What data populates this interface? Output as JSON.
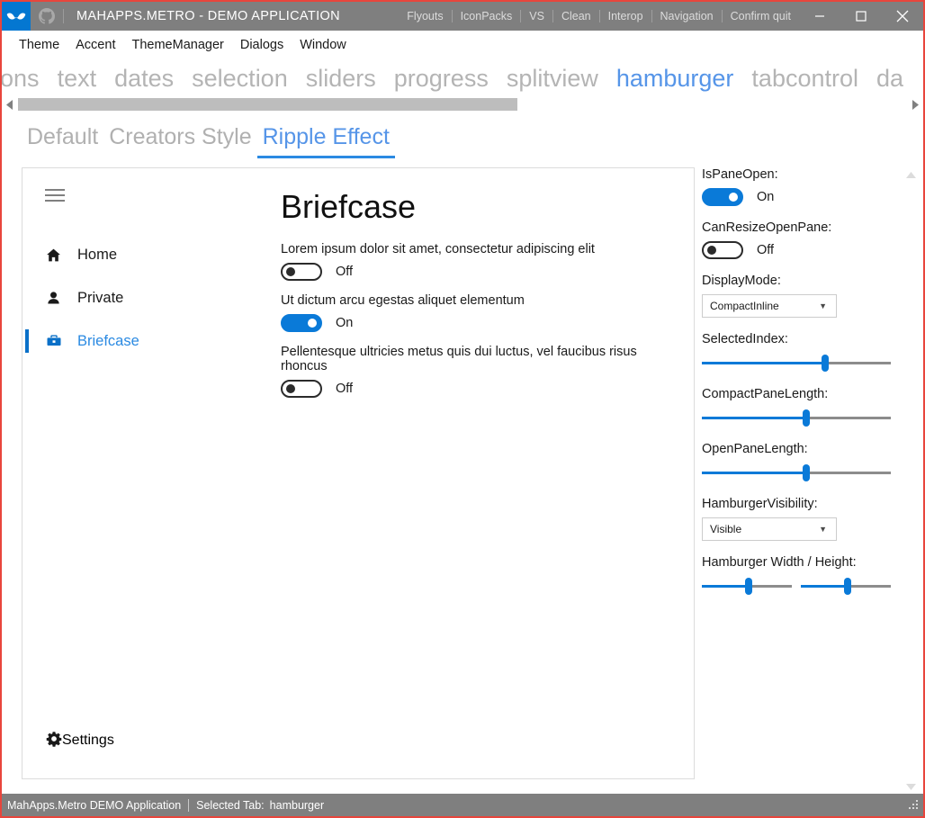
{
  "titlebar": {
    "logo_icon": "mahapps-mustache-logo",
    "github_icon": "github-octocat-icon",
    "title": "MAHAPPS.METRO - DEMO APPLICATION",
    "menu_items": [
      "Flyouts",
      "IconPacks",
      "VS",
      "Clean",
      "Interop",
      "Navigation",
      "Confirm quit"
    ],
    "window_buttons": [
      "minimize",
      "maximize",
      "close"
    ],
    "background": "#7f7f7f",
    "logo_background": "#0477d1"
  },
  "menubar": {
    "items": [
      "Theme",
      "Accent",
      "ThemeManager",
      "Dialogs",
      "Window"
    ]
  },
  "tabstrip": {
    "tabs": [
      {
        "label": "uttons",
        "selected": false
      },
      {
        "label": "text",
        "selected": false
      },
      {
        "label": "dates",
        "selected": false
      },
      {
        "label": "selection",
        "selected": false
      },
      {
        "label": "sliders",
        "selected": false
      },
      {
        "label": "progress",
        "selected": false
      },
      {
        "label": "splitview",
        "selected": false
      },
      {
        "label": "hamburger",
        "selected": true
      },
      {
        "label": "tabcontrol",
        "selected": false
      },
      {
        "label": "da",
        "selected": false
      }
    ],
    "scroll_left_icon": "chevron-left-icon",
    "scroll_right_icon": "chevron-right-icon",
    "accent_color": "#5695e8"
  },
  "subtabs": {
    "tabs": [
      {
        "label": "Default",
        "selected": false
      },
      {
        "label": "Creators Style",
        "selected": false
      },
      {
        "label": "Ripple Effect",
        "selected": true
      }
    ]
  },
  "splitview": {
    "hamburger_icon": "hamburger-menu-icon",
    "nav_items": [
      {
        "label": "Home",
        "icon": "home-icon",
        "selected": false
      },
      {
        "label": "Private",
        "icon": "person-icon",
        "selected": false
      },
      {
        "label": "Briefcase",
        "icon": "briefcase-icon",
        "selected": true
      }
    ],
    "settings_item": {
      "label": "Settings",
      "icon": "gear-icon"
    },
    "content": {
      "heading": "Briefcase",
      "toggles": [
        {
          "description": "Lorem ipsum dolor sit amet, consectetur adipiscing elit",
          "state_label": "Off",
          "on": false
        },
        {
          "description": "Ut dictum arcu egestas aliquet elementum",
          "state_label": "On",
          "on": true
        },
        {
          "description": "Pellentesque ultricies metus quis dui luctus, vel faucibus risus rhoncus",
          "state_label": "Off",
          "on": false
        }
      ]
    }
  },
  "settings_panel": {
    "is_pane_open": {
      "label": "IsPaneOpen:",
      "state_label": "On",
      "on": true
    },
    "can_resize_open_pane": {
      "label": "CanResizeOpenPane:",
      "state_label": "Off",
      "on": false
    },
    "display_mode": {
      "label": "DisplayMode:",
      "value": "CompactInline",
      "caret_icon": "chevron-down-icon"
    },
    "selected_index": {
      "label": "SelectedIndex:",
      "percent": 65
    },
    "compact_pane_length": {
      "label": "CompactPaneLength:",
      "percent": 55
    },
    "open_pane_length": {
      "label": "OpenPaneLength:",
      "percent": 55
    },
    "hamburger_visibility": {
      "label": "HamburgerVisibility:",
      "value": "Visible",
      "caret_icon": "chevron-down-icon"
    },
    "hamburger_size": {
      "label": "Hamburger Width / Height:",
      "width_percent": 52,
      "height_percent": 52
    }
  },
  "scrollbar": {
    "up_icon": "scroll-up-arrow-icon",
    "down_icon": "scroll-down-arrow-icon"
  },
  "statusbar": {
    "app_name": "MahApps.Metro DEMO Application",
    "selected_tab_label": "Selected Tab:",
    "selected_tab_value": "hamburger",
    "resize_grip_icon": "resize-grip-icon"
  },
  "colors": {
    "accent": "#0a7ad8",
    "window_border": "#e8453c",
    "chrome": "#7f7f7f",
    "tab_accent": "#5695e8"
  }
}
